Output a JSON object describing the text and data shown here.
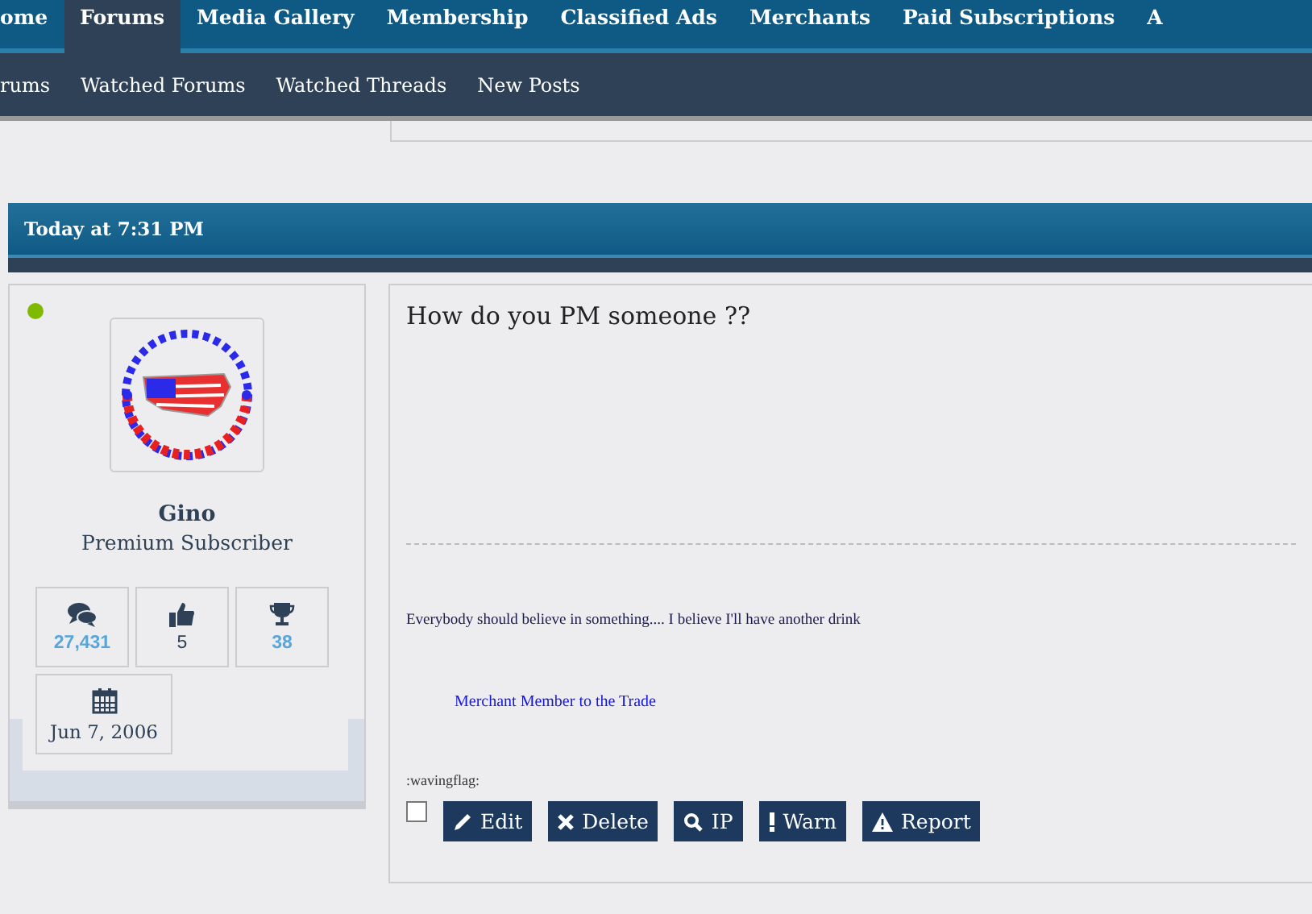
{
  "nav_tabs": [
    {
      "label": "ome",
      "selected": false
    },
    {
      "label": "Forums",
      "selected": true
    },
    {
      "label": "Media Gallery",
      "selected": false
    },
    {
      "label": "Membership",
      "selected": false
    },
    {
      "label": "Classified Ads",
      "selected": false
    },
    {
      "label": "Merchants",
      "selected": false
    },
    {
      "label": "Paid Subscriptions",
      "selected": false
    },
    {
      "label": "A",
      "selected": false
    }
  ],
  "sub_nav": [
    "rums",
    "Watched Forums",
    "Watched Threads",
    "New Posts"
  ],
  "post": {
    "timestamp": "Today at 7:31 PM",
    "user": {
      "online": true,
      "name": "Gino",
      "title": "Premium Subscriber",
      "stats": [
        {
          "kind": "messages",
          "value": "27,431",
          "link": true
        },
        {
          "kind": "likes",
          "value": "5",
          "link": false
        },
        {
          "kind": "trophies",
          "value": "38",
          "link": true
        },
        {
          "kind": "joined",
          "value": "Jun 7, 2006",
          "link": false
        }
      ]
    },
    "message": "How do you PM someone ??",
    "signature": {
      "quote": "Everybody should believe in something.... I believe I'll have another drink",
      "link": "Merchant Member to the Trade",
      "smilie": ":wavingflag:"
    },
    "select_checked": false,
    "actions": [
      {
        "kind": "edit",
        "label": "Edit"
      },
      {
        "kind": "delete",
        "label": "Delete"
      },
      {
        "kind": "ip",
        "label": "IP"
      },
      {
        "kind": "warn",
        "label": "Warn"
      },
      {
        "kind": "report",
        "label": "Report"
      }
    ]
  }
}
